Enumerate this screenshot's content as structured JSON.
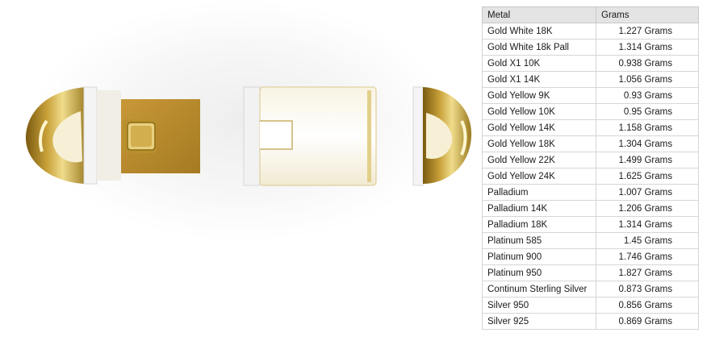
{
  "table": {
    "headers": {
      "metal": "Metal",
      "grams": "Grams"
    },
    "rows": [
      {
        "metal": "Gold White 18K",
        "grams": "1.227 Grams"
      },
      {
        "metal": "Gold White 18k Pall",
        "grams": "1.314 Grams"
      },
      {
        "metal": "Gold X1 10K",
        "grams": "0.938 Grams"
      },
      {
        "metal": "Gold X1 14K",
        "grams": "1.056 Grams"
      },
      {
        "metal": "Gold Yellow 9K",
        "grams": "0.93 Grams"
      },
      {
        "metal": "Gold Yellow 10K",
        "grams": "0.95 Grams"
      },
      {
        "metal": "Gold Yellow 14K",
        "grams": "1.158 Grams"
      },
      {
        "metal": "Gold Yellow 18K",
        "grams": "1.304 Grams"
      },
      {
        "metal": "Gold Yellow 22K",
        "grams": "1.499 Grams"
      },
      {
        "metal": "Gold Yellow 24K",
        "grams": "1.625 Grams"
      },
      {
        "metal": "Palladium",
        "grams": "1.007 Grams"
      },
      {
        "metal": "Palladium 14K",
        "grams": "1.206 Grams"
      },
      {
        "metal": "Palladium 18K",
        "grams": "1.314 Grams"
      },
      {
        "metal": "Platinum 585",
        "grams": "1.45 Grams"
      },
      {
        "metal": "Platinum 900",
        "grams": "1.746 Grams"
      },
      {
        "metal": "Platinum 950",
        "grams": "1.827 Grams"
      },
      {
        "metal": "Continum Sterling Silver",
        "grams": "0.873 Grams"
      },
      {
        "metal": "Silver 950",
        "grams": "0.856 Grams"
      },
      {
        "metal": "Silver 925",
        "grams": "0.869 Grams"
      }
    ]
  },
  "colors": {
    "gold": "#c9a23a",
    "gold_dark": "#8a6a12",
    "white_part": "#f2f2f2"
  }
}
